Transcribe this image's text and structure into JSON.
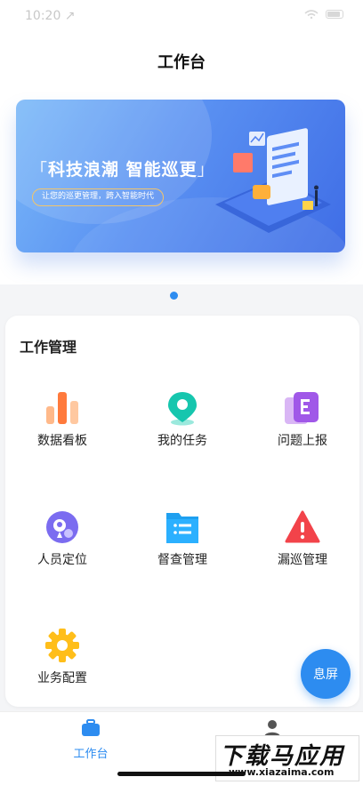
{
  "status_bar": {
    "time": "10:20 ↗"
  },
  "header": {
    "title": "工作台"
  },
  "banner": {
    "title": "科技浪潮 智能巡更",
    "subtitle": "让您的巡更管理，跨入智能时代"
  },
  "work": {
    "section_title": "工作管理",
    "items": [
      {
        "label": "数据看板",
        "icon": "bar-chart-icon"
      },
      {
        "label": "我的任务",
        "icon": "location-pin-icon"
      },
      {
        "label": "问题上报",
        "icon": "report-icon"
      },
      {
        "label": "人员定位",
        "icon": "person-location-icon"
      },
      {
        "label": "督查管理",
        "icon": "folder-list-icon"
      },
      {
        "label": "漏巡管理",
        "icon": "warning-icon"
      },
      {
        "label": "业务配置",
        "icon": "gear-icon"
      }
    ]
  },
  "float_button": {
    "label": "息屏"
  },
  "tabbar": {
    "tabs": [
      {
        "label": "工作台",
        "icon": "briefcase-icon",
        "active": true
      },
      {
        "label": "",
        "icon": "user-icon",
        "active": false
      }
    ]
  },
  "watermark": {
    "main": "下载马应用",
    "url": "www.xiazaima.com"
  },
  "colors": {
    "accent": "#2d8cf0",
    "background": "#f4f5f7"
  }
}
